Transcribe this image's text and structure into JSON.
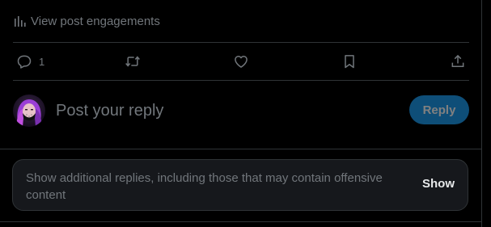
{
  "engagements": {
    "label": "View post engagements",
    "icon": "bar-chart-icon"
  },
  "actions": {
    "reply": {
      "icon": "reply-icon",
      "count": "1"
    },
    "repost": {
      "icon": "repost-icon"
    },
    "like": {
      "icon": "heart-icon"
    },
    "bookmark": {
      "icon": "bookmark-icon"
    },
    "share": {
      "icon": "share-icon"
    }
  },
  "composer": {
    "placeholder": "Post your reply",
    "value": "",
    "button_label": "Reply",
    "avatar": "user-avatar"
  },
  "notice": {
    "text": "Show additional replies, including those that may contain offensive content",
    "button_label": "Show"
  },
  "colors": {
    "background": "#000000",
    "muted": "#71767b",
    "divider": "#2f3336",
    "accent": "#1d9bf0",
    "card": "#16181c",
    "text": "#e7e9ea"
  }
}
